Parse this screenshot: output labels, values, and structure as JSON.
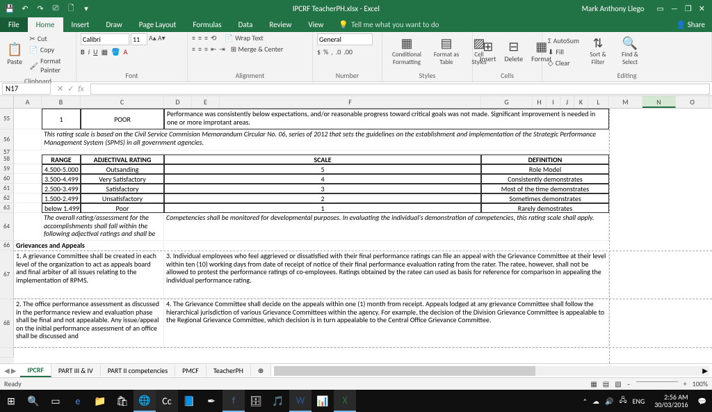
{
  "titlebar": {
    "filename": "IPCRF TeacherPH.xlsx - Excel",
    "user": "Mark Anthony Llego"
  },
  "ribbon": {
    "tabs": {
      "file": "File",
      "home": "Home",
      "insert": "Insert",
      "draw": "Draw",
      "pagelayout": "Page Layout",
      "formulas": "Formulas",
      "data": "Data",
      "review": "Review",
      "view": "View"
    },
    "tellme": "Tell me what you want to do",
    "share": "Share",
    "clipboard": {
      "paste": "Paste",
      "cut": "Cut",
      "copy": "Copy",
      "painter": "Format Painter",
      "label": "Clipboard"
    },
    "font": {
      "name": "Calibri",
      "size": "11",
      "label": "Font"
    },
    "alignment": {
      "wrap": "Wrap Text",
      "merge": "Merge & Center",
      "label": "Alignment"
    },
    "number": {
      "fmt": "General",
      "label": "Number"
    },
    "styles": {
      "cond": "Conditional Formatting",
      "tbl": "Format as Table",
      "cell": "Cell Styles",
      "label": "Styles"
    },
    "cells": {
      "insert": "Insert",
      "delete": "Delete",
      "format": "Format",
      "label": "Cells"
    },
    "editing": {
      "autosum": "AutoSum",
      "fill": "Fill",
      "clear": "Clear",
      "sort": "Sort & Filter",
      "find": "Find & Select",
      "label": "Editing"
    }
  },
  "namebox": "N17",
  "columns": [
    "A",
    "B",
    "C",
    "D",
    "E",
    "F",
    "G",
    "H",
    "I",
    "J",
    "K",
    "L",
    "M",
    "N",
    "O"
  ],
  "content": {
    "poor_num": "1",
    "poor_label": "POOR",
    "poor_desc": "Performance was consistently below expectations, and/or reasonable progress toward critical goals was not made.  Significant improvement is needed in one or more improtant areas.",
    "scale_note": "This rating scale is based on the Civil Service Commision Memorandum Circular No. 06, series of 2012 that sets the guidelines on the establishment and implementation of the Strategic Performance Management System (SPMS) in all government agencies.",
    "hdr_range": "RANGE",
    "hdr_adj": "ADJECTIVAL RATING",
    "hdr_scale": "SCALE",
    "hdr_def": "DEFINITION",
    "rows": [
      {
        "range": "4.500-5.000",
        "adj": "Outsanding",
        "scale": "5",
        "def": "Role Model"
      },
      {
        "range": "3.500-4.499",
        "adj": "Very Satisfactory",
        "scale": "4",
        "def": "Consistently demonstrates"
      },
      {
        "range": "2.500-3.499",
        "adj": "Satisfactory",
        "scale": "3",
        "def": "Most of the time demonstrates"
      },
      {
        "range": "1.500-2.499",
        "adj": "Unsatisfactory",
        "scale": "2",
        "def": "Sometimes demonstrates"
      },
      {
        "range": "below 1.499",
        "adj": "Poor",
        "scale": "1",
        "def": "Rarely demostrates"
      }
    ],
    "overall_note": "The overall rating/assessment for the accomplishments shall fall within the following adjectival ratings and shall be",
    "comp_note": "Competencies shall be monitored for developmental purposes. In evaluating the individual's demonstration of competencies, this rating scale shall apply.",
    "grievances_title": "Grievances and Appeals",
    "g1": "1. A grievance Committee shall be created in each level of the organization to act as appeals board and final arbiter of all issues relating to the implementation of RPMS.",
    "g2": "2. The office performance assessment as discussed in the performance review and evaluation phase shall be final and not appealable. Any issue/appeal on the initial performance assessment of an office shall be discussed and",
    "g3": "3. Individual employees who feel aggrieved or dissatisfied with their final performance ratings can file an appeal with the Grievance Committee at their level within ten (10) working days from date of receipt of notice of their final performance evaluation rating from the rater. The ratee, however, shall not be allowed to protest the performance ratings of co-employees. Ratings obtained by the ratee can used as basis for reference for comparison in appealing the individual performance rating.",
    "g4": "4. The Grievance Committee shall decide on the appeals within one (1) month from receipt. Appeals lodged at any grievance Committee shall follow the hierarchical jurisdiction of various Grievance Committees within the agency. For example, the decision of the Division Grievance Committee is appealable to the Regional Grievance Committee, which decision is in turn appealable to the Central Office Grievance Committee."
  },
  "sheets": {
    "s1": "IPCRF",
    "s2": "PART III & IV",
    "s3": "PART II competencies",
    "s4": "PMCF",
    "s5": "TeacherPH"
  },
  "status": {
    "ready": "Ready",
    "zoom": "100%"
  },
  "taskbar": {
    "lang": "ENG",
    "time": "2:56 AM",
    "date": "30/03/2016"
  }
}
